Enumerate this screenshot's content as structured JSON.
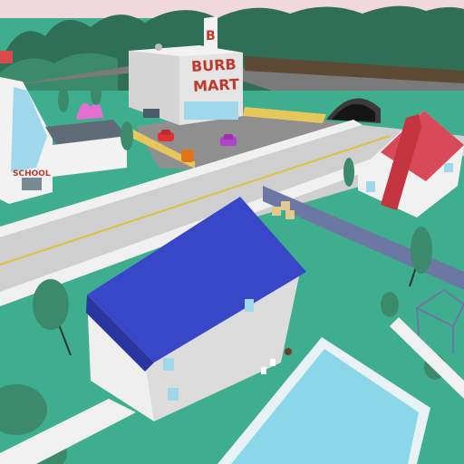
{
  "scene": {
    "type": "3d-town-diorama",
    "signs": {
      "store_letter": "B",
      "store_line1": "BURB",
      "store_line2": "MART",
      "school": "SCHOOL"
    },
    "colors": {
      "grass": "#3fae8e",
      "forest": "#2f6f58",
      "road": "#cfcfcf",
      "road_line": "#e0c040",
      "store_wall": "#f2f2f2",
      "store_text": "#c0392b",
      "blue_roof": "#3846c8",
      "red_roof": "#d84a5a",
      "pool_water": "#8ad7ea",
      "school_glass": "#9fd8ea"
    }
  }
}
